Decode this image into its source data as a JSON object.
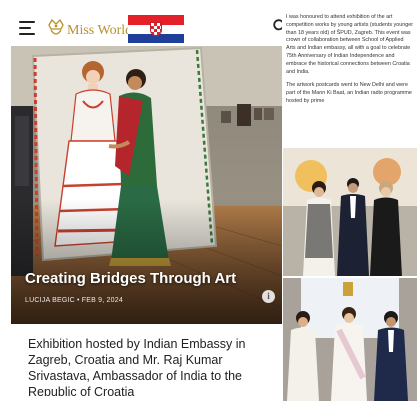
{
  "header": {
    "brand": "Miss World",
    "menu_icon": "hamburger-menu-icon",
    "logo_icon": "crown-logo-icon",
    "flag_icon": "croatia-flag-icon",
    "search_icon": "search-icon"
  },
  "hero": {
    "title": "Creating Bridges Through Art",
    "meta": "LUCIJA BEGIC • FEB 9, 2024",
    "info_icon": "info-icon",
    "info_glyph": "i"
  },
  "caption": "Exhibition hosted by Indian Embassy in Zagreb, Croatia and Mr. Raj Kumar Srivastava, Ambassador of India to the Republic of Croatia",
  "side_text": {
    "p1": "I was honoured to attend exhibition of the art competition works by young artists (students younger than 18 years old) of ŠPUD, Zagreb. This event was crown of collaboration between School of Applied Arts and Indian embassy, all with a goal to celebrate 75th Anniversary of Indian Independence and embrace the historical connections between Croatia and India.",
    "p2": "The artwork postcards went to New Delhi and were part of the Mann Ki Baat, an Indian radio programme hosted by prime"
  },
  "colors": {
    "brand_gold": "#b8902c",
    "flag_red": "#e4202a",
    "flag_blue": "#1f3f9a"
  }
}
